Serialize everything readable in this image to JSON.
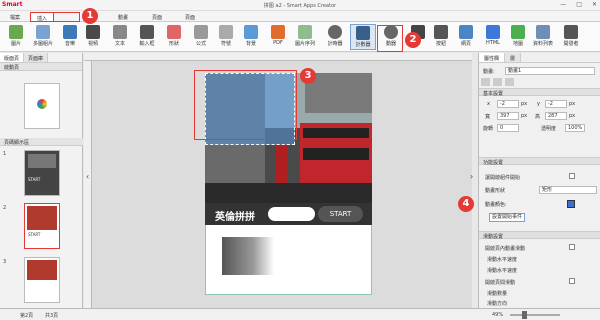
{
  "window": {
    "title": "拼图 a2 - Smart Apps Creator",
    "logo": "Smart",
    "controls": [
      "—",
      "□",
      "✕"
    ]
  },
  "menu": {
    "items": [
      "檔案",
      "插入",
      "頁面",
      "動畫",
      "頁面",
      "頁面"
    ]
  },
  "toolbar": {
    "items": [
      "圖片",
      "多圖組片",
      "音樂",
      "視頻",
      "文本",
      "輸入框",
      "形狀",
      "公式",
      "符號",
      "背景",
      "PDF",
      "圖片序列",
      "計時器",
      "計數器",
      "動器",
      "",
      "按鈕",
      "網頁",
      "HTML",
      "地圖",
      "資料列表",
      "開發者",
      ""
    ]
  },
  "left_panel": {
    "tabs": [
      "版面頁",
      "頁面庫"
    ],
    "section1": "啟動頁",
    "section2": "頁碼顯示區",
    "page_numbers": [
      "1",
      "2",
      "3"
    ],
    "thumb_labels": [
      "START",
      "START"
    ]
  },
  "canvas": {
    "game_title": "英倫拼拼",
    "start_label": "START"
  },
  "right_panel": {
    "tabs": [
      "屬性欄",
      "層"
    ],
    "name_label": "動畫:",
    "name_value": "動畫1",
    "section_basic": "基本設置",
    "x_label": "x",
    "x_value": "-2",
    "y_label": "y",
    "y_value": "-2",
    "px1": "px",
    "px2": "px",
    "w_label": "寬",
    "w_value": "397",
    "h_label": "高",
    "h_value": "287",
    "px3": "px",
    "px4": "px",
    "rot_label": "旋轉",
    "rot_value": "0",
    "opacity_label": "透明度",
    "opacity_value": "100%",
    "section_func": "功能設置",
    "row1": "讓開啟組件開始",
    "row2": "動畫形狀",
    "shape_value": "矩形",
    "row3": "動畫顏色:",
    "btn_event": "設置開始事件",
    "section_scroll": "滑動設置",
    "s1": "開啟頁內動畫滑動",
    "s2": "滑動水平速度",
    "s3": "滑動水平速度",
    "s4": "開啟頁間滑動",
    "s5": "滑動數量",
    "s6": "滑動方向"
  },
  "callouts": [
    "1",
    "2",
    "3",
    "4"
  ],
  "status": {
    "page_info": "第2頁",
    "total": "共3頁",
    "zoom": "49%"
  },
  "colors": {
    "accent": "#e53935",
    "select_blue": "#7aa3d1"
  }
}
